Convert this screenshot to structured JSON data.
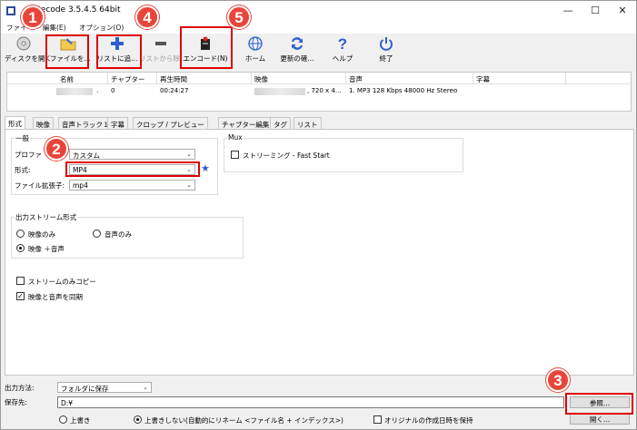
{
  "window": {
    "title": "Recode 3.5.4.5 64bit"
  },
  "menu": {
    "items": [
      "ファイ",
      "編集(E)",
      "オプション(O)"
    ]
  },
  "toolbar": {
    "buttons": [
      {
        "label": "ディスクを開く",
        "icon": "disc-icon"
      },
      {
        "label": "ファイルを...",
        "icon": "folder-open-icon"
      },
      {
        "label": "リストに追...",
        "icon": "plus-icon"
      },
      {
        "label": "リストから除...",
        "icon": "minus-icon"
      },
      {
        "label": "エンコード(N)",
        "icon": "encode-icon"
      },
      {
        "label": "ホーム",
        "icon": "globe-icon"
      },
      {
        "label": "更新の確...",
        "icon": "refresh-icon"
      },
      {
        "label": "ヘルプ",
        "icon": "question-icon"
      },
      {
        "label": "終了",
        "icon": "power-icon"
      }
    ]
  },
  "file_list": {
    "headers": [
      "名前",
      "チャプター",
      "再生時間",
      "映像",
      "音声",
      "字幕"
    ],
    "rows": [
      {
        "name": ".",
        "chapter": "0",
        "duration": "00:24:27",
        "video": ", 720 x 4...",
        "audio": "1. MP3 128 Kbps 48000 Hz Stereo",
        "subtitle": ""
      }
    ]
  },
  "tabs": [
    "形式",
    "映像",
    "音声トラック１",
    "字幕",
    "クロップ / プレビュー",
    "チャプター編集",
    "タグ",
    "リスト"
  ],
  "format": {
    "general_title": "一般",
    "profile_label": "プロファ",
    "profile_value": "カスタム",
    "format_label": "形式:",
    "format_value": "MP4",
    "ext_label": "ファイル拡張子:",
    "ext_value": "mp4",
    "mux_title": "Mux",
    "streaming_label": "ストリーミング - Fast Start",
    "output_stream_title": "出力ストリーム形式",
    "video_only": "映像のみ",
    "audio_only": "音声のみ",
    "video_audio": "映像 ＋音声",
    "stream_copy_label": "ストリームのみコピー",
    "sync_label": "映像と音声を同期"
  },
  "output": {
    "method_label": "出力方法:",
    "method_value": "フォルダに保存",
    "dest_label": "保存先:",
    "dest_value": "D:¥",
    "browse_label": "参照...",
    "open_label": "開く...",
    "overwrite_label": "上書き",
    "no_overwrite_label": "上書きしない(自動的にリネーム <ファイル名 + インデックス>)",
    "keep_date_label": "オリジナルの作成日時を保持"
  },
  "annotations": [
    "1",
    "2",
    "3",
    "4",
    "5"
  ],
  "colors": {
    "highlight": "#e00000",
    "badge": "#e8453a"
  }
}
